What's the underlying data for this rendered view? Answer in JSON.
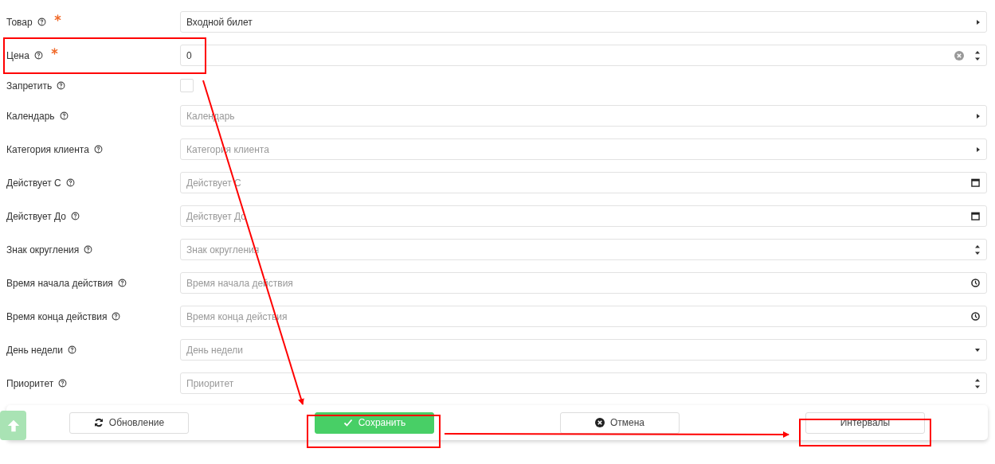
{
  "fields": [
    {
      "label": "Товар",
      "required": true,
      "kind": "select",
      "value": "Входной билет"
    },
    {
      "label": "Цена",
      "required": true,
      "kind": "number",
      "value": "0",
      "clearable": true
    },
    {
      "label": "Запретить",
      "required": false,
      "kind": "checkbox",
      "checked": false
    },
    {
      "label": "Календарь",
      "required": false,
      "kind": "select",
      "placeholder": "Календарь"
    },
    {
      "label": "Категория клиента",
      "required": false,
      "kind": "select",
      "placeholder": "Категория клиента"
    },
    {
      "label": "Действует С",
      "required": false,
      "kind": "date",
      "placeholder": "Действует С"
    },
    {
      "label": "Действует До",
      "required": false,
      "kind": "date",
      "placeholder": "Действует До"
    },
    {
      "label": "Знак округления",
      "required": false,
      "kind": "number",
      "placeholder": "Знак округления",
      "clearable": false
    },
    {
      "label": "Время начала действия",
      "required": false,
      "kind": "time",
      "placeholder": "Время начала действия"
    },
    {
      "label": "Время конца действия",
      "required": false,
      "kind": "time",
      "placeholder": "Время конца действия"
    },
    {
      "label": "День недели",
      "required": false,
      "kind": "dropdown",
      "placeholder": "День недели"
    },
    {
      "label": "Приоритет",
      "required": false,
      "kind": "number",
      "placeholder": "Приоритет",
      "clearable": false
    }
  ],
  "footer": {
    "buttons": [
      {
        "label": "Обновление",
        "kind": "refresh"
      },
      {
        "label": "Сохранить",
        "kind": "save"
      },
      {
        "label": "Отмена",
        "kind": "cancel"
      },
      {
        "label": "Интервалы",
        "kind": "plain"
      }
    ]
  }
}
